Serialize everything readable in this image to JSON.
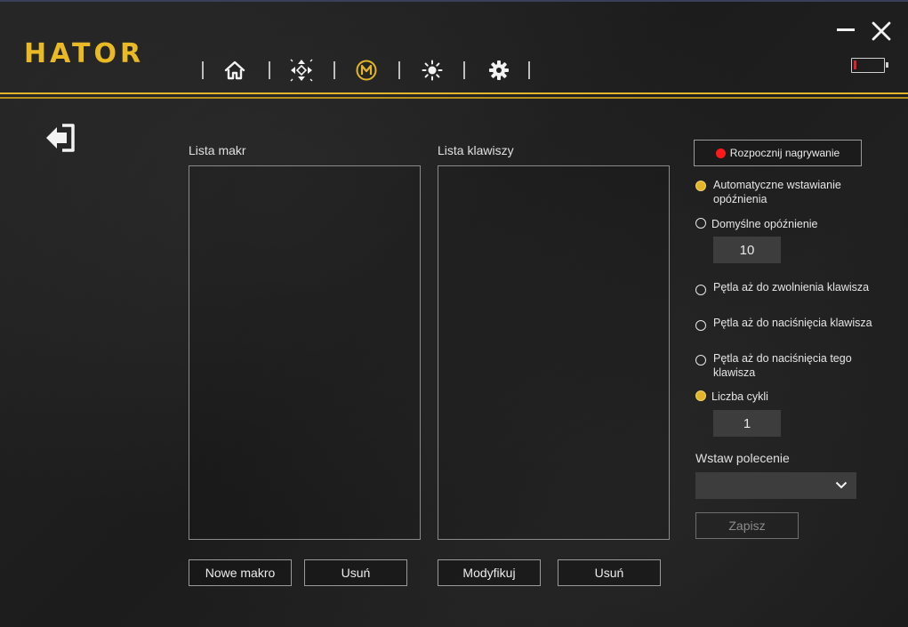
{
  "app": {
    "logo": "HATOR",
    "accent_color": "#e3b62a",
    "record_color": "#ff1a1a"
  },
  "nav": {
    "items": [
      {
        "icon": "home-icon"
      },
      {
        "icon": "dpad-icon"
      },
      {
        "icon": "macro-icon",
        "active": true
      },
      {
        "icon": "brightness-icon"
      },
      {
        "icon": "gear-icon"
      }
    ]
  },
  "window": {
    "minimize_icon": "minimize-icon",
    "close_icon": "close-icon",
    "battery_icon": "battery-icon",
    "battery_level": 0.05
  },
  "macro_list": {
    "title": "Lista makr",
    "items": [],
    "new_button": "Nowe makro",
    "delete_button": "Usuń"
  },
  "key_list": {
    "title": "Lista klawiszy",
    "items": [],
    "modify_button": "Modyfikuj",
    "delete_button": "Usuń"
  },
  "settings": {
    "record_button": "Rozpocznij nagrywanie",
    "auto_delay": {
      "label": "Automatyczne wstawianie opóźnienia",
      "selected": true
    },
    "default_delay": {
      "label": "Domyślne opóźnienie",
      "selected": false,
      "value": "10"
    },
    "loop_release": {
      "label": "Pętla aż do zwolnienia klawisza",
      "selected": false
    },
    "loop_press": {
      "label": "Pętla aż do naciśnięcia klawisza",
      "selected": false
    },
    "loop_press_this": {
      "label": "Pętla aż do naciśnięcia tego klawisza",
      "selected": false
    },
    "cycle_count": {
      "label": "Liczba cykli",
      "selected": true,
      "value": "1"
    },
    "insert_command_label": "Wstaw polecenie",
    "insert_command_value": "",
    "save_button": "Zapisz"
  }
}
